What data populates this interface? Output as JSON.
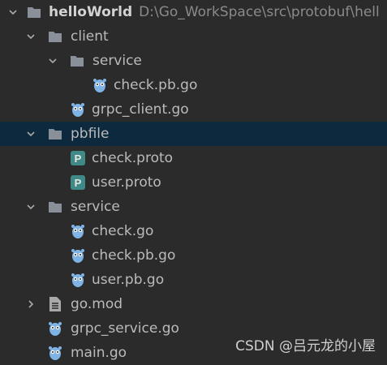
{
  "tree": {
    "root": {
      "name": "helloWorld",
      "path": "D:\\Go_WorkSpace\\src\\protobuf\\hell"
    },
    "client": {
      "label": "client"
    },
    "client_service": {
      "label": "service"
    },
    "client_service_check_pb": {
      "label": "check.pb.go"
    },
    "grpc_client": {
      "label": "grpc_client.go"
    },
    "pbfile": {
      "label": "pbfile"
    },
    "check_proto": {
      "label": "check.proto"
    },
    "user_proto": {
      "label": "user.proto"
    },
    "service": {
      "label": "service"
    },
    "service_check": {
      "label": "check.go"
    },
    "service_check_pb": {
      "label": "check.pb.go"
    },
    "service_user_pb": {
      "label": "user.pb.go"
    },
    "go_mod": {
      "label": "go.mod"
    },
    "grpc_service": {
      "label": "grpc_service.go"
    },
    "main_go": {
      "label": "main.go"
    }
  },
  "watermark": "CSDN @吕元龙的小屋",
  "colors": {
    "background": "#2b2b2b",
    "selected_row": "#0d293e",
    "folder": "#8a9099",
    "gopher": "#7fb3e6",
    "proto": "#3f8a86"
  }
}
